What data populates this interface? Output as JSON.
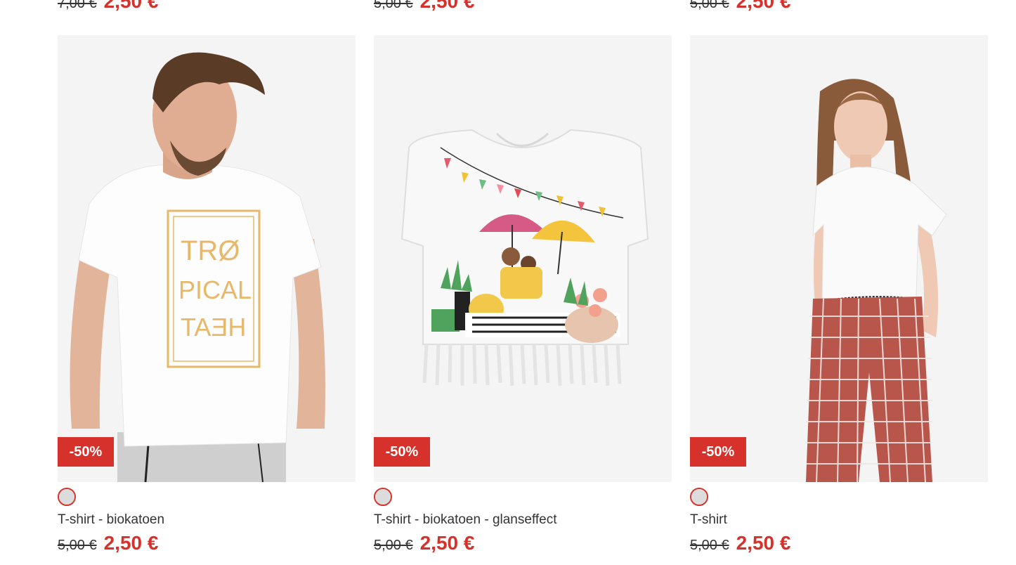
{
  "top_row": [
    {
      "old_price": "7,00 €",
      "new_price": "2,50 €"
    },
    {
      "old_price": "5,00 €",
      "new_price": "2,50 €"
    },
    {
      "old_price": "5,00 €",
      "new_price": "2,50 €"
    }
  ],
  "products": [
    {
      "badge": "-50%",
      "name": "T-shirt - biokatoen",
      "old_price": "5,00 €",
      "new_price": "2,50 €",
      "image": "man-white-tshirt-tropical-print",
      "print_lines": [
        "TRØ",
        "PICAL",
        "TAƎH"
      ]
    },
    {
      "badge": "-50%",
      "name": "T-shirt - biokatoen - glanseffect",
      "old_price": "5,00 €",
      "new_price": "2,50 €",
      "image": "kids-tshirt-umbrella-print-fringe"
    },
    {
      "badge": "-50%",
      "name": "T-shirt",
      "old_price": "5,00 €",
      "new_price": "2,50 €",
      "image": "woman-white-tshirt-checked-pants"
    }
  ],
  "colors": {
    "accent": "#d6312a",
    "swatch": "#dcdcdc"
  }
}
